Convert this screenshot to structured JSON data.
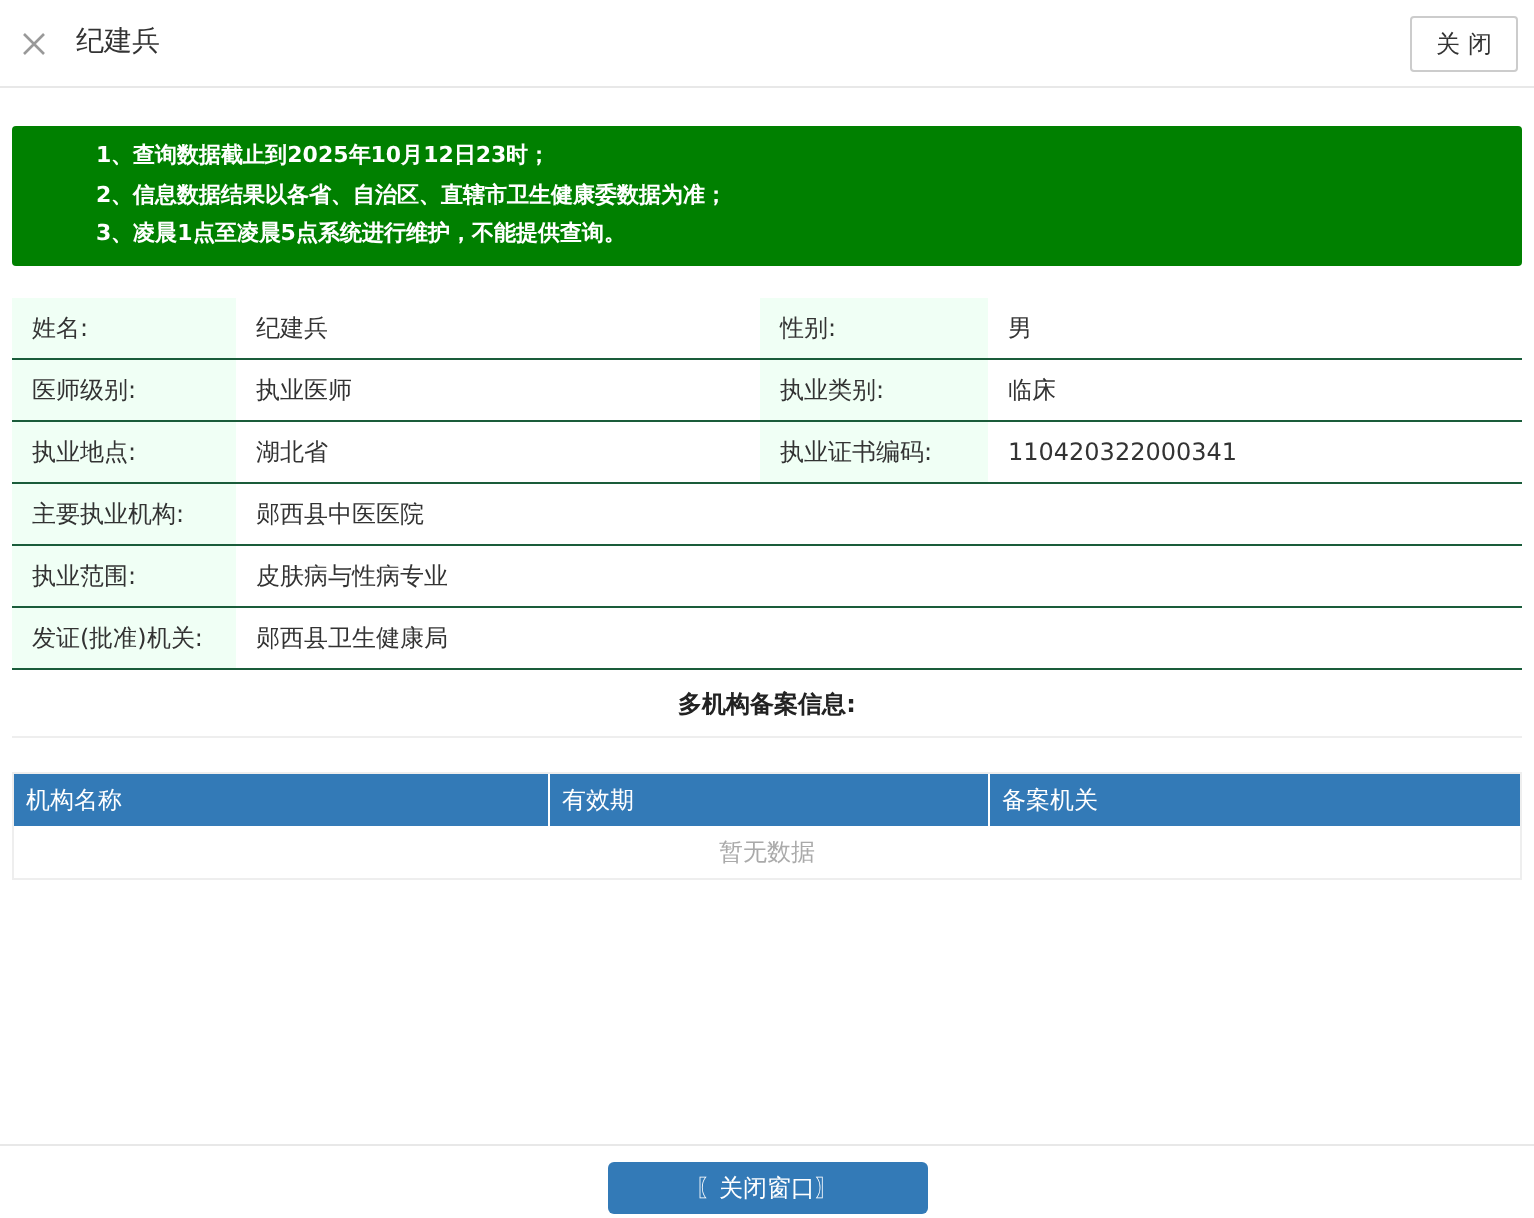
{
  "header": {
    "title": "纪建兵",
    "close_button": "关 闭"
  },
  "notices": [
    "1、查询数据截止到2025年10月12日23时；",
    "2、信息数据结果以各省、自治区、直辖市卫生健康委数据为准；",
    "3、凌晨1点至凌晨5点系统进行维护，不能提供查询。"
  ],
  "info_rows": [
    {
      "cells": [
        {
          "label": "姓名:",
          "value": "纪建兵"
        },
        {
          "label": "性别:",
          "value": "男"
        }
      ]
    },
    {
      "cells": [
        {
          "label": "医师级别:",
          "value": "执业医师"
        },
        {
          "label": "执业类别:",
          "value": "临床"
        }
      ]
    },
    {
      "cells": [
        {
          "label": "执业地点:",
          "value": "湖北省"
        },
        {
          "label": "执业证书编码:",
          "value": "110420322000341"
        }
      ]
    },
    {
      "cells": [
        {
          "label": "主要执业机构:",
          "value": "郧西县中医医院"
        }
      ]
    },
    {
      "cells": [
        {
          "label": "执业范围:",
          "value": "皮肤病与性病专业"
        }
      ]
    },
    {
      "cells": [
        {
          "label": "发证(批准)机关:",
          "value": "郧西县卫生健康局"
        }
      ]
    }
  ],
  "records": {
    "title": "多机构备案信息:",
    "columns": [
      "机构名称",
      "有效期",
      "备案机关"
    ],
    "empty_text": "暂无数据"
  },
  "footer_button": "〖关闭窗口〗"
}
